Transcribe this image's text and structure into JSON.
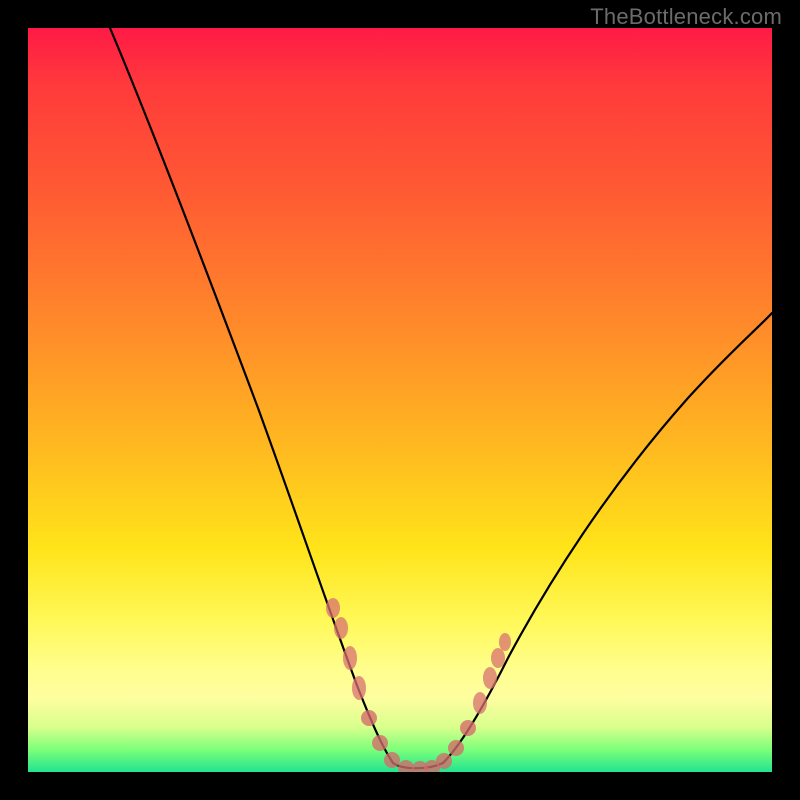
{
  "attribution": "TheBottleneck.com",
  "colors": {
    "background_frame": "#000000",
    "gradient_top": "#ff1a46",
    "gradient_mid": "#ffe41a",
    "gradient_bottom": "#22e38f",
    "curve": "#000000",
    "marker": "#d46a6a"
  },
  "chart_data": {
    "type": "line",
    "title": "",
    "xlabel": "",
    "ylabel": "",
    "xlim": [
      0,
      100
    ],
    "ylim": [
      0,
      100
    ],
    "series": [
      {
        "name": "left-arm",
        "x": [
          11,
          15,
          20,
          25,
          30,
          35,
          38,
          40,
          42,
          43,
          44,
          45,
          46,
          47,
          48
        ],
        "y": [
          100,
          90,
          78,
          66,
          53,
          40,
          31,
          25,
          19,
          15,
          11,
          8,
          5,
          3,
          1
        ]
      },
      {
        "name": "valley-floor",
        "x": [
          48,
          50,
          52,
          54,
          56
        ],
        "y": [
          1,
          0,
          0,
          0,
          1
        ]
      },
      {
        "name": "right-arm",
        "x": [
          56,
          58,
          60,
          63,
          68,
          75,
          82,
          90,
          100
        ],
        "y": [
          1,
          4,
          8,
          14,
          24,
          36,
          46,
          55,
          62
        ]
      }
    ],
    "markers": {
      "name": "highlight-points",
      "points": [
        {
          "x": 41,
          "y": 22
        },
        {
          "x": 42,
          "y": 19
        },
        {
          "x": 43.5,
          "y": 14
        },
        {
          "x": 44.5,
          "y": 10
        },
        {
          "x": 46,
          "y": 6
        },
        {
          "x": 47.5,
          "y": 3
        },
        {
          "x": 49,
          "y": 1
        },
        {
          "x": 50.5,
          "y": 0.5
        },
        {
          "x": 52,
          "y": 0.5
        },
        {
          "x": 53.5,
          "y": 0.5
        },
        {
          "x": 55,
          "y": 1
        },
        {
          "x": 56.5,
          "y": 2
        },
        {
          "x": 58,
          "y": 4.5
        },
        {
          "x": 60,
          "y": 8.5
        },
        {
          "x": 61.5,
          "y": 12
        },
        {
          "x": 62.5,
          "y": 15
        },
        {
          "x": 63.5,
          "y": 17
        }
      ]
    }
  }
}
